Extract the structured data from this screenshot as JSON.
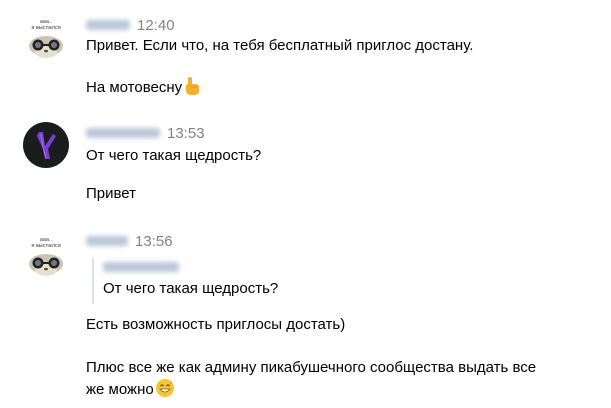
{
  "messages": [
    {
      "time": "12:40",
      "avatar": "cat-with-glasses-avatar",
      "texts": [
        "Привет. Если что, на тебя бесплатный приглос достану.",
        "На мотовесну"
      ],
      "emoji": "pointing-up-hand-emoji"
    },
    {
      "time": "13:53",
      "avatar": "purple-logo-avatar",
      "texts": [
        "От чего такая щедрость?",
        "Привет"
      ]
    },
    {
      "time": "13:56",
      "avatar": "cat-with-glasses-avatar",
      "quote": {
        "text": "От чего такая щедрость?"
      },
      "texts": [
        "Есть возможность приглосы достать)",
        "Плюс все же как админу пикабушечного сообщества выдать все",
        "же можно"
      ],
      "emoji": "grinning-sweat-emoji"
    }
  ],
  "colors": {
    "text": "#000000",
    "time": "#828282",
    "quote_bar": "#dbe1e8",
    "avatar2_bg": "#1b1c1e",
    "avatar2_logo": "#7a3fd1"
  }
}
